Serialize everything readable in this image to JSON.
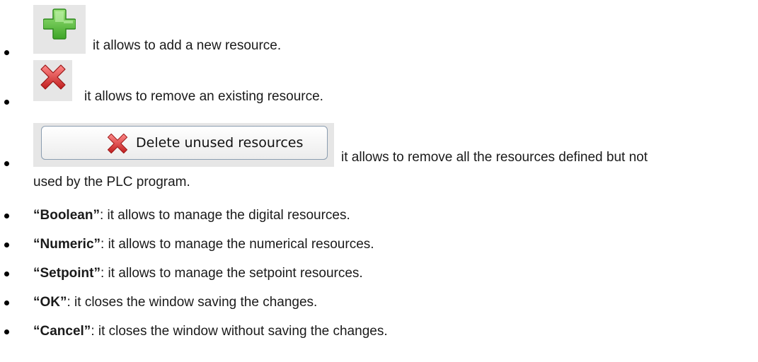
{
  "items": [
    {
      "icon": "add-plus-icon",
      "text": "it allows to add a new resource."
    },
    {
      "icon": "remove-cross-icon",
      "text": "it allows to remove an existing resource."
    },
    {
      "button_label": "Delete unused resources",
      "button_icon": "remove-cross-icon",
      "text_line1": "it allows to remove all the resources defined but not",
      "text_line2": "used by the PLC program."
    },
    {
      "term": "“Boolean”",
      "text": ": it allows to manage the digital resources."
    },
    {
      "term": "“Numeric”",
      "text": ": it allows to manage the numerical resources."
    },
    {
      "term": "“Setpoint”",
      "text": ": it allows to manage the setpoint resources."
    },
    {
      "term": "“OK”",
      "text": ": it closes the window saving the changes."
    },
    {
      "term": "“Cancel”",
      "text": ": it closes the window without saving the changes."
    }
  ],
  "colors": {
    "plus_green": "#5cc13a",
    "cross_red": "#d83a3a",
    "button_border": "#8b9db0"
  }
}
